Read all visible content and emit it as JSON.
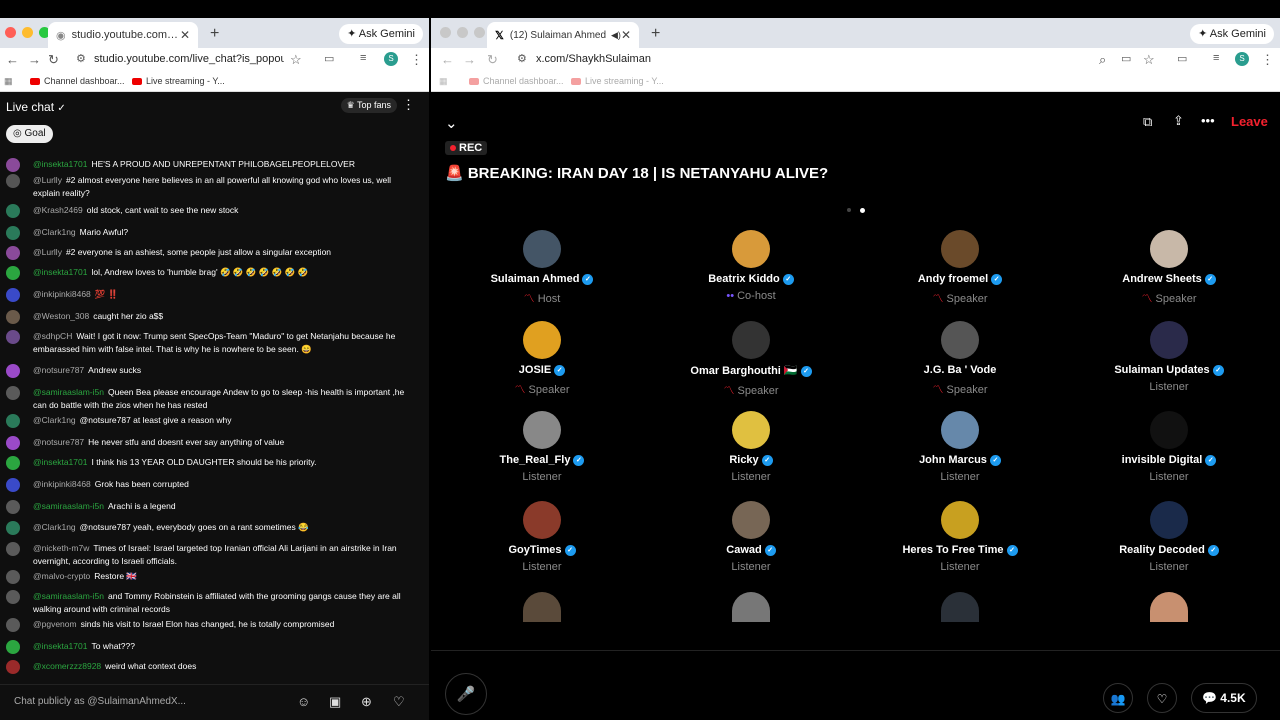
{
  "left_window": {
    "tab_title": "studio.youtube.com/live_chat",
    "url": "studio.youtube.com/live_chat?is_popout...",
    "ask_gemini": "Ask Gemini",
    "bookmarks": [
      "Channel dashboar...",
      "Live streaming - Y..."
    ],
    "chat": {
      "title": "Live chat",
      "top_fans": "Top fans",
      "goal": "Goal",
      "input_placeholder": "Chat publicly as @SulaimanAhmedX...",
      "messages": [
        {
          "user": "@insekta1701",
          "text": "HE'S A PROUD AND UNREPENTANT PHILOBAGELPEOPLELOVER",
          "color": "#2ba640"
        },
        {
          "user": "@Lurlly",
          "text": "#2 almost everyone here believes in an all powerful all knowing god who loves us, well explain reality?",
          "color": "#aaa"
        },
        {
          "user": "@Krash2469",
          "text": "old stock, cant wait to see the new stock",
          "color": "#aaa"
        },
        {
          "user": "@Clark1ng",
          "text": "Mario Awful?",
          "color": "#aaa"
        },
        {
          "user": "@Lurlly",
          "text": "#2 everyone is an ashiest, some people just allow a singular exception",
          "color": "#aaa"
        },
        {
          "user": "@insekta1701",
          "text": "lol, Andrew loves to 'humble brag' 🤣 🤣 🤣 🤣 🤣 🤣 🤣",
          "color": "#2ba640"
        },
        {
          "user": "@inkipinki8468",
          "text": "💯 ‼️",
          "color": "#aaa"
        },
        {
          "user": "@Weston_308",
          "text": "caught her zio a$$",
          "color": "#aaa"
        },
        {
          "user": "@sdhpCH",
          "text": "Wait! I got it now: Trump sent SpecOps-Team \"Maduro\" to get Netanjahu because he embarassed him with false intel. That is why he is nowhere to be seen. 😄",
          "color": "#aaa"
        },
        {
          "user": "@notsure787",
          "text": "Andrew sucks",
          "color": "#aaa"
        },
        {
          "user": "@samiraaslam-i5n",
          "text": "Queen Bea please encourage Andew to go to sleep -his health is important ,he can do battle with the zios when he has rested",
          "color": "#2ba640"
        },
        {
          "user": "@Clark1ng",
          "text": "@notsure787 at least give a reason why",
          "color": "#aaa"
        },
        {
          "user": "@notsure787",
          "text": "He never stfu and doesnt ever say anything of value",
          "color": "#aaa"
        },
        {
          "user": "@insekta1701",
          "text": "I think his 13 YEAR OLD DAUGHTER should be his priority.",
          "color": "#2ba640"
        },
        {
          "user": "@inkipinki8468",
          "text": "Grok has been corrupted",
          "color": "#aaa"
        },
        {
          "user": "@samiraaslam-i5n",
          "text": "Arachi is a legend",
          "color": "#2ba640"
        },
        {
          "user": "@Clark1ng",
          "text": "@notsure787 yeah, everybody goes on a rant sometimes 😂",
          "color": "#aaa"
        },
        {
          "user": "@nicketh-m7w",
          "text": "Times of Israel: Israel targeted top Iranian official Ali Larijani in an airstrike in Iran overnight, according to Israeli officials.",
          "color": "#aaa"
        },
        {
          "user": "@malvo-crypto",
          "text": "Restore 🇬🇧",
          "color": "#aaa"
        },
        {
          "user": "@samiraaslam-i5n",
          "text": "and Tommy Robinstein is affiliated with the grooming gangs cause they are all walking around with criminal records",
          "color": "#2ba640"
        },
        {
          "user": "@pgvenom",
          "text": "sinds his visit to Israel Elon has changed, he is totally compromised",
          "color": "#aaa"
        },
        {
          "user": "@insekta1701",
          "text": "To what???",
          "color": "#2ba640"
        },
        {
          "user": "@xcomerzzz8928",
          "text": "weird what context does",
          "color": "#2ba640"
        }
      ]
    }
  },
  "right_window": {
    "tab_title": "(12) Sulaiman Ahmed (@S...",
    "url": "x.com/ShaykhSulaiman",
    "ask_gemini": "Ask Gemini",
    "bookmarks": [
      "Channel dashboar...",
      "Live streaming - Y..."
    ],
    "space": {
      "leave": "Leave",
      "rec": "REC",
      "title": "🚨 BREAKING: IRAN DAY 18 | IS NETANYAHU ALIVE?",
      "participants": [
        {
          "name": "Sulaiman Ahmed",
          "role": "Host",
          "verified": true
        },
        {
          "name": "Beatrix Kiddo",
          "role": "Co-host",
          "verified": true
        },
        {
          "name": "Andy froemel",
          "role": "Speaker",
          "verified": true
        },
        {
          "name": "Andrew Sheets",
          "role": "Speaker",
          "verified": true
        },
        {
          "name": "JOSIE",
          "role": "Speaker",
          "verified": true
        },
        {
          "name": "Omar Barghouthi 🇵🇸",
          "role": "Speaker",
          "verified": true
        },
        {
          "name": "J.G. Ba ' Vode",
          "role": "Speaker",
          "verified": false
        },
        {
          "name": "Sulaiman Updates",
          "role": "Listener",
          "verified": true
        },
        {
          "name": "The_Real_Fly",
          "role": "Listener",
          "verified": true
        },
        {
          "name": "Ricky",
          "role": "Listener",
          "verified": true
        },
        {
          "name": "John Marcus",
          "role": "Listener",
          "verified": true
        },
        {
          "name": "invisible Digital",
          "role": "Listener",
          "verified": true
        },
        {
          "name": "GoyTimes",
          "role": "Listener",
          "verified": true
        },
        {
          "name": "Cawad",
          "role": "Listener",
          "verified": true
        },
        {
          "name": "Heres To Free Time",
          "role": "Listener",
          "verified": true
        },
        {
          "name": "Reality Decoded",
          "role": "Listener",
          "verified": true
        }
      ],
      "comment_count": "4.5K"
    }
  }
}
